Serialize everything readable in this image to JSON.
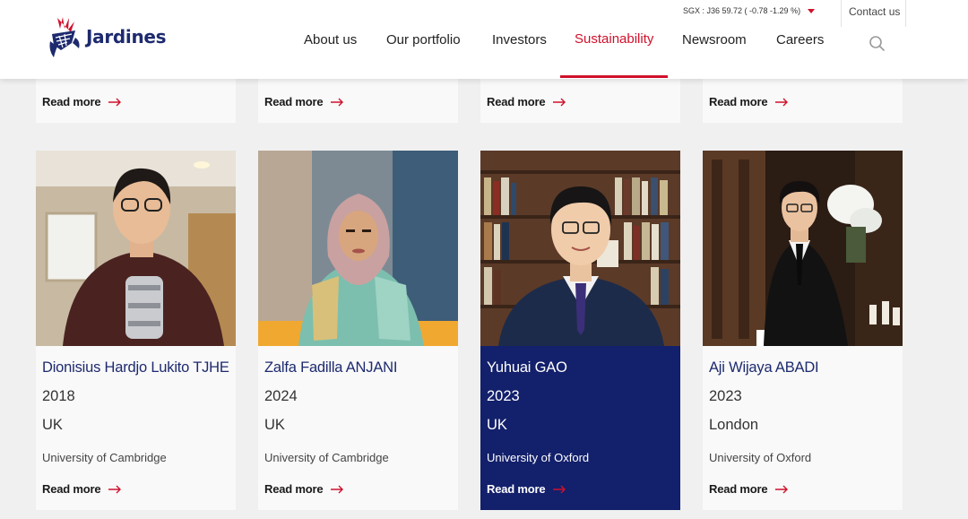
{
  "brand": {
    "name": "Jardines",
    "accent": "#d0112b",
    "navy": "#13206b"
  },
  "header": {
    "stock_text": "SGX : J36 59.72 ( -0.78 -1.29 %)",
    "stock_direction": "down",
    "contact_label": "Contact us",
    "search_icon": "search-icon",
    "nav": [
      {
        "label": "About us"
      },
      {
        "label": "Our portfolio"
      },
      {
        "label": "Investors"
      },
      {
        "label": "Sustainability",
        "active": true
      },
      {
        "label": "Newsroom"
      },
      {
        "label": "Careers"
      }
    ]
  },
  "top_row": [
    {
      "read_more": "Read more"
    },
    {
      "read_more": "Read more"
    },
    {
      "read_more": "Read more"
    },
    {
      "read_more": "Read more"
    }
  ],
  "scholars": [
    {
      "name": "Dionisius Hardjo Lukito TJHE",
      "year": "2018",
      "country": "UK",
      "university": "University of Cambridge",
      "read_more": "Read more"
    },
    {
      "name": "Zalfa Fadilla ANJANI",
      "year": "2024",
      "country": "UK",
      "university": "University of Cambridge",
      "read_more": "Read more"
    },
    {
      "name": "Yuhuai GAO",
      "year": "2023",
      "country": "UK",
      "university": "University of Oxford",
      "read_more": "Read more",
      "highlighted": true
    },
    {
      "name": "Aji Wijaya ABADI",
      "year": "2023",
      "country": "London",
      "university": "University of Oxford",
      "read_more": "Read more"
    }
  ]
}
